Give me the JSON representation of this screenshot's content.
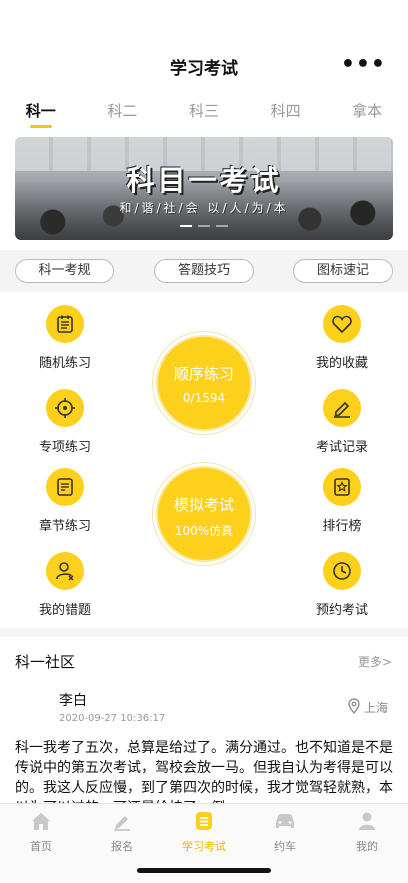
{
  "header": {
    "title": "学习考试",
    "more_label": "•••"
  },
  "tabs": [
    {
      "label": "科一",
      "active": true
    },
    {
      "label": "科二",
      "active": false
    },
    {
      "label": "科三",
      "active": false
    },
    {
      "label": "科四",
      "active": false
    },
    {
      "label": "拿本",
      "active": false
    }
  ],
  "banner": {
    "title": "科目一考试",
    "subtitle": "和/谐/社/会 以/人/为/本"
  },
  "chips": [
    "科一考规",
    "答题技巧",
    "图标速记"
  ],
  "functions": {
    "left": [
      {
        "label": "随机练习",
        "icon": "list-doc-icon"
      },
      {
        "label": "专项练习",
        "icon": "target-icon"
      },
      {
        "label": "章节练习",
        "icon": "chapter-icon"
      },
      {
        "label": "我的错题",
        "icon": "user-error-icon"
      }
    ],
    "right": [
      {
        "label": "我的收藏",
        "icon": "heart-icon"
      },
      {
        "label": "考试记录",
        "icon": "pen-icon"
      },
      {
        "label": "排行榜",
        "icon": "ranking-icon"
      },
      {
        "label": "预约考试",
        "icon": "clock-icon"
      }
    ],
    "sequential": {
      "title": "顺序练习",
      "progress": "0/1594"
    },
    "mock": {
      "title": "模拟考试",
      "sub": "100%仿真"
    }
  },
  "community": {
    "title": "科一社区",
    "more_label": "更多>",
    "post": {
      "user": "李白",
      "time": "2020-09-27 10:36:17",
      "location": "上海",
      "content": "科一我考了五次，总算是给过了。满分通过。也不知道是不是传说中的第五次考试，驾校会放一马。但我自认为考得是可以的。我这人反应慢，到了第四次的时候，我才觉驾轻就熟，本以为可以过的，可还是给挂了，倒"
    }
  },
  "tabbar": [
    {
      "label": "首页",
      "icon": "home-icon",
      "active": false
    },
    {
      "label": "报名",
      "icon": "signup-pen-icon",
      "active": false
    },
    {
      "label": "学习考试",
      "icon": "study-exam-icon",
      "active": true
    },
    {
      "label": "约车",
      "icon": "car-icon",
      "active": false
    },
    {
      "label": "我的",
      "icon": "profile-icon",
      "active": false
    }
  ],
  "colors": {
    "accent": "#fdd01b",
    "active_tab": "#f0b400"
  }
}
